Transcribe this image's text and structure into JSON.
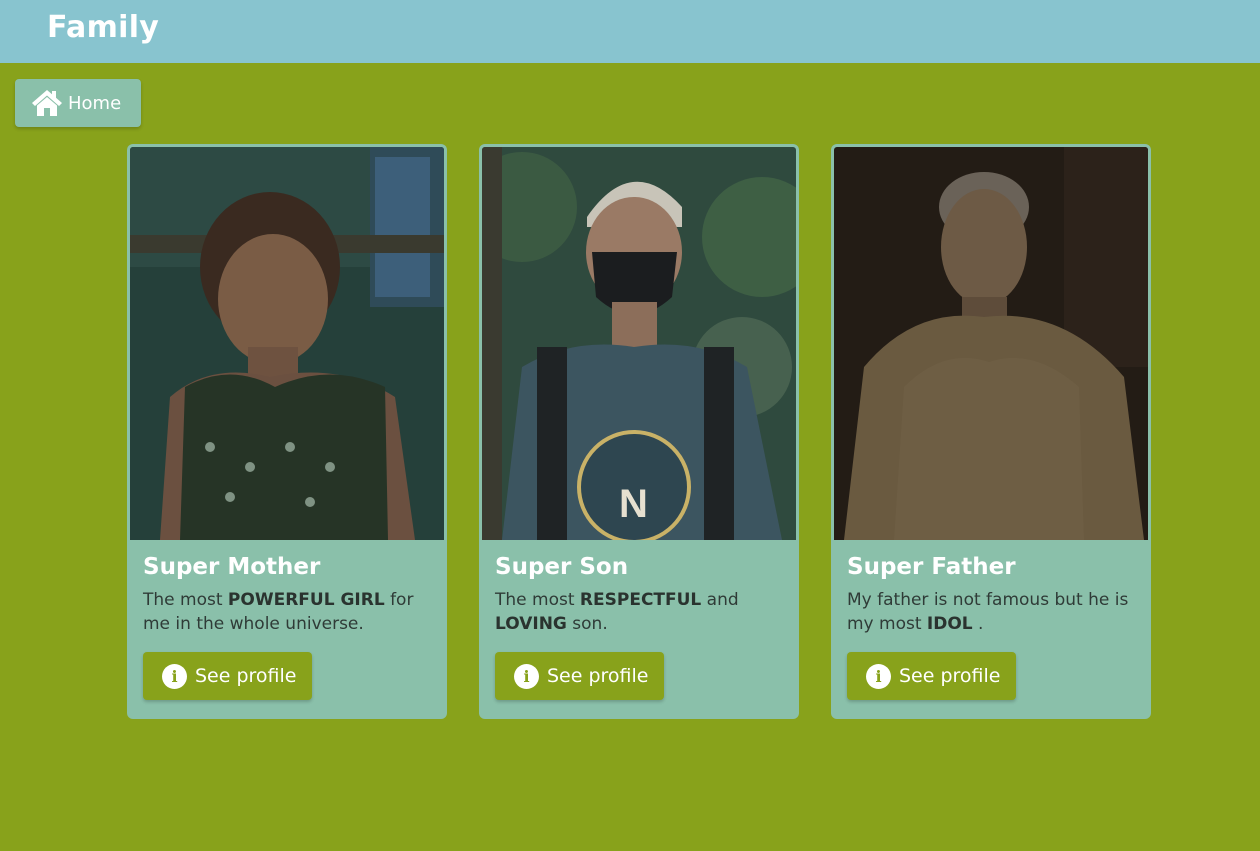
{
  "app": {
    "title": "Family"
  },
  "nav": {
    "home_label": "Home",
    "home_icon": "home-icon"
  },
  "colors": {
    "topbar": "#88c4cf",
    "background": "#88a21b",
    "card": "#8ac0aa",
    "button": "#88a21b"
  },
  "cards": [
    {
      "title": "Super Mother",
      "desc_prefix": "The most ",
      "desc_bold1": "POWERFUL GIRL",
      "desc_mid": " for me in the whole universe.",
      "desc_bold2": "",
      "desc_suffix": "",
      "button_label": "See profile",
      "button_icon": "info-icon"
    },
    {
      "title": "Super Son",
      "desc_prefix": "The most ",
      "desc_bold1": "RESPECTFUL",
      "desc_mid": " and ",
      "desc_bold2": "LOVING",
      "desc_suffix": " son.",
      "button_label": "See profile",
      "button_icon": "info-icon"
    },
    {
      "title": "Super Father",
      "desc_prefix": "My father is not famous but he is my most ",
      "desc_bold1": "IDOL",
      "desc_mid": " .",
      "desc_bold2": "",
      "desc_suffix": "",
      "button_label": "See profile",
      "button_icon": "info-icon"
    }
  ]
}
